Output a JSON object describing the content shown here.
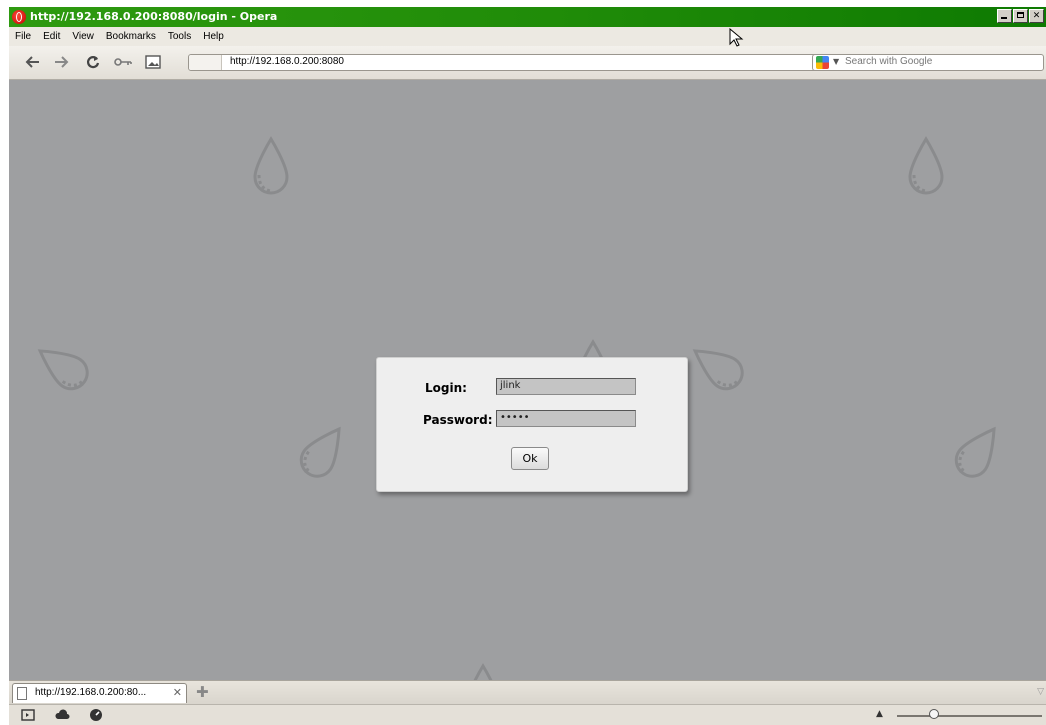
{
  "window": {
    "title": "http://192.168.0.200:8080/login - Opera",
    "controls": [
      "minimize",
      "maximize",
      "close"
    ]
  },
  "menu": {
    "items": [
      "File",
      "Edit",
      "View",
      "Bookmarks",
      "Tools",
      "Help"
    ]
  },
  "toolbar": {
    "address": "http://192.168.0.200:8080",
    "search_placeholder": "Search with Google"
  },
  "login": {
    "login_label": "Login:",
    "login_value": "jlink",
    "password_label": "Password:",
    "password_value": "•••••",
    "ok_label": "Ok"
  },
  "tabs": {
    "items": [
      {
        "title": "http://192.168.0.200:80..."
      }
    ]
  },
  "icons": {
    "back": "arrow-left-icon",
    "forward": "arrow-right-icon",
    "reload": "reload-icon",
    "key": "key-icon",
    "image": "image-icon",
    "panel": "panel-toggle-icon",
    "cloud": "unite-cloud-icon",
    "turbo": "turbo-speed-icon"
  },
  "colors": {
    "titlebar": "#1f8b08",
    "content_bg": "#9e9fa1",
    "dialog_bg": "#eeeeee"
  }
}
